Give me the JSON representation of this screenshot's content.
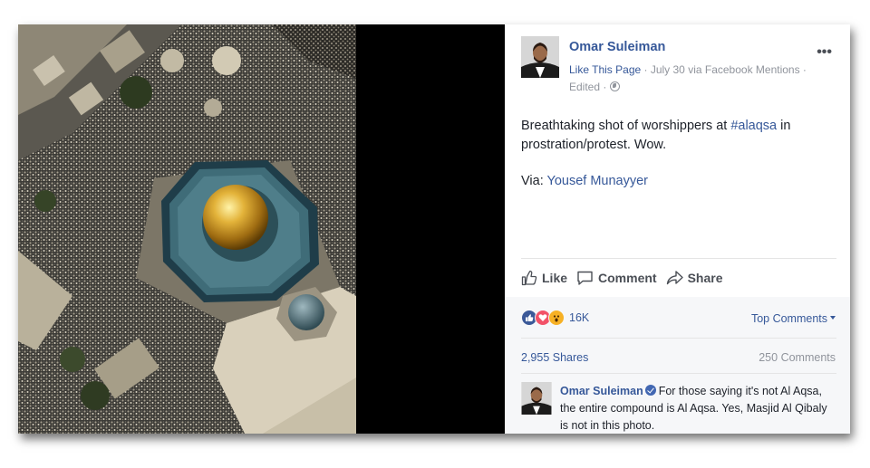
{
  "post": {
    "author": "Omar Suleiman",
    "page_link": "Like This Page",
    "meta_rest": " · July 30 via Facebook Mentions ·",
    "edited": "Edited ·",
    "text_before": "Breathtaking shot of worshippers at ",
    "hashtag": "#alaqsa",
    "text_after": " in prostration/protest. Wow.",
    "via_label": "Via: ",
    "via_name": "Yousef Munayyer",
    "more_icon": "ellipsis-icon",
    "photo_subject": "aerial-photo-dome-of-the-rock"
  },
  "actions": {
    "like": "Like",
    "comment": "Comment",
    "share": "Share"
  },
  "footer": {
    "reaction_count": "16K",
    "top_comments": "Top Comments",
    "shares": "2,955 Shares",
    "comments": "250 Comments"
  },
  "comment": {
    "author": "Omar Suleiman",
    "text": "For those saying it's not Al Aqsa, the entire compound is Al Aqsa. Yes, Masjid Al Qibaly is not in this photo."
  },
  "colors": {
    "link": "#365899",
    "meta": "#90949c",
    "text": "#1d2129",
    "footer_bg": "#f6f7f9"
  }
}
